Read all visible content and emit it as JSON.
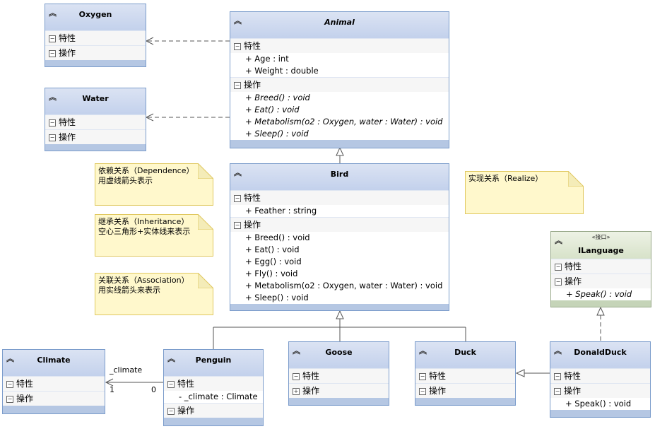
{
  "sections": {
    "attributes": "特性",
    "operations": "操作"
  },
  "icons": {
    "collapse": "chevron-double-up-icon",
    "expanded": "minus-box-icon",
    "collapsed": "plus-box-icon"
  },
  "classes": {
    "oxygen": {
      "name": "Oxygen",
      "attributes": [],
      "operations": []
    },
    "water": {
      "name": "Water",
      "attributes": [],
      "operations": []
    },
    "animal": {
      "name": "Animal",
      "abstract": true,
      "attributes": [
        "+ Age : int",
        "+ Weight : double"
      ],
      "operations": [
        "+ Breed() : void",
        "+ Eat() : void",
        "+ Metabolism(o2 : Oxygen, water : Water) : void",
        "+ Sleep() : void"
      ]
    },
    "bird": {
      "name": "Bird",
      "attributes": [
        "+ Feather : string"
      ],
      "operations": [
        "+ Breed() : void",
        "+ Eat() : void",
        "+ Egg() : void",
        "+ Fly() : void",
        "+ Metabolism(o2 : Oxygen, water : Water) : void",
        "+ Sleep() : void"
      ]
    },
    "ilanguage": {
      "name": "ILanguage",
      "stereotype": "«接口»",
      "attributes": [],
      "operations": [
        "+ Speak() : void"
      ]
    },
    "climate": {
      "name": "Climate",
      "attributes": [],
      "operations": []
    },
    "penguin": {
      "name": "Penguin",
      "attributes": [
        "- _climate : Climate"
      ],
      "operations": []
    },
    "goose": {
      "name": "Goose",
      "attributes": [],
      "operations": [],
      "operations_collapsed": true
    },
    "duck": {
      "name": "Duck",
      "attributes": [],
      "operations": []
    },
    "donaldduck": {
      "name": "DonaldDuck",
      "attributes": [],
      "operations": [
        "+ Speak() : void"
      ]
    }
  },
  "notes": [
    {
      "line1": "依赖关系（Dependence）",
      "line2": "用虚线箭头表示"
    },
    {
      "line1": "继承关系（Inheritance）",
      "line2": "空心三角形+实体线来表示"
    },
    {
      "line1": "关联关系（Association）",
      "line2": "用实线箭头来表示"
    },
    {
      "line1": "实现关系（Realize）",
      "line2": ""
    }
  ],
  "association": {
    "role": "_climate",
    "target_multiplicity": "1",
    "source_multiplicity": "0"
  }
}
